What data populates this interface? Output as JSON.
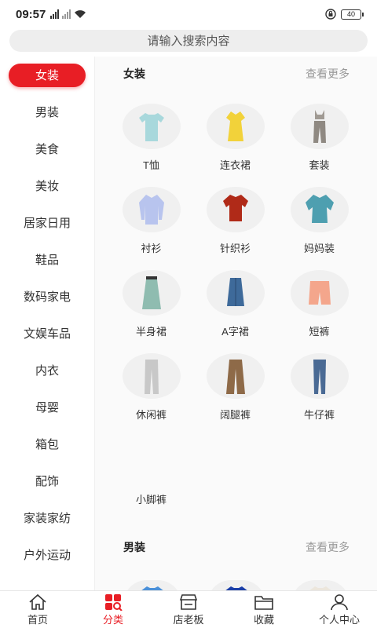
{
  "status": {
    "time": "09:57",
    "battery": "40"
  },
  "search": {
    "placeholder": "请输入搜索内容"
  },
  "sidebar": {
    "items": [
      {
        "label": "女装",
        "active": true
      },
      {
        "label": "男装"
      },
      {
        "label": "美食"
      },
      {
        "label": "美妆"
      },
      {
        "label": "居家日用"
      },
      {
        "label": "鞋品"
      },
      {
        "label": "数码家电"
      },
      {
        "label": "文娱车品"
      },
      {
        "label": "内衣"
      },
      {
        "label": "母婴"
      },
      {
        "label": "箱包"
      },
      {
        "label": "配饰"
      },
      {
        "label": "家装家纺"
      },
      {
        "label": "户外运动"
      }
    ]
  },
  "sections": [
    {
      "title": "女装",
      "more": "查看更多",
      "items": [
        {
          "label": "T恤",
          "icon": "tshirt-icon",
          "color": "#a8d8dc"
        },
        {
          "label": "连衣裙",
          "icon": "dress-icon",
          "color": "#f2d23a"
        },
        {
          "label": "套装",
          "icon": "set-icon",
          "color": "#a09a93"
        },
        {
          "label": "衬衫",
          "icon": "shirt-icon",
          "color": "#b8c4ee"
        },
        {
          "label": "针织衫",
          "icon": "knit-icon",
          "color": "#b02a18"
        },
        {
          "label": "妈妈装",
          "icon": "blouse-icon",
          "color": "#4e9fb0"
        },
        {
          "label": "半身裙",
          "icon": "skirt-icon",
          "color": "#8fbcb0"
        },
        {
          "label": "A字裙",
          "icon": "aline-skirt-icon",
          "color": "#3e6a9a"
        },
        {
          "label": "短裤",
          "icon": "shorts-icon",
          "color": "#f4a68c"
        },
        {
          "label": "休闲裤",
          "icon": "casual-pants-icon",
          "color": "#c8c8c8"
        },
        {
          "label": "阔腿裤",
          "icon": "wide-pants-icon",
          "color": "#8e6a48"
        },
        {
          "label": "牛仔裤",
          "icon": "jeans-icon",
          "color": "#4a6a94"
        }
      ],
      "extra": "小脚裤"
    },
    {
      "title": "男装",
      "more": "查看更多"
    }
  ],
  "nav": [
    {
      "label": "首页",
      "icon": "home-icon"
    },
    {
      "label": "分类",
      "icon": "category-icon",
      "active": true
    },
    {
      "label": "店老板",
      "icon": "store-icon"
    },
    {
      "label": "收藏",
      "icon": "folder-icon"
    },
    {
      "label": "个人中心",
      "icon": "user-icon"
    }
  ],
  "colors": {
    "accent": "#e81e25"
  }
}
